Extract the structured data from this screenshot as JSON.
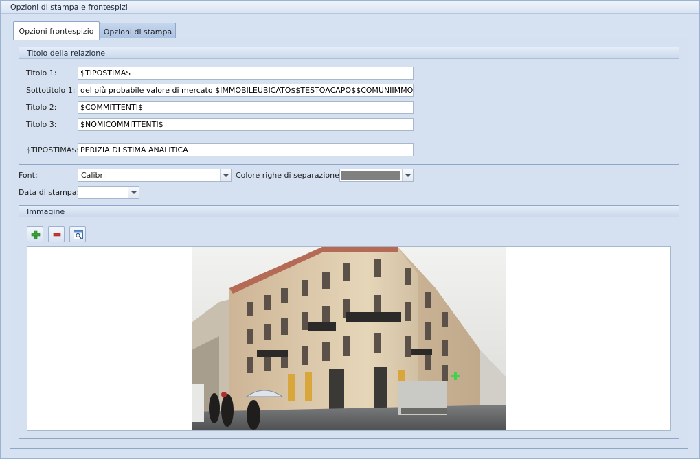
{
  "window": {
    "title": "Opzioni di stampa e frontespizi"
  },
  "tabs": [
    {
      "label": "Opzioni frontespizio",
      "active": true
    },
    {
      "label": "Opzioni di stampa",
      "active": false
    }
  ],
  "titolo_relazione": {
    "header": "Titolo della relazione",
    "fields": [
      {
        "label": "Titolo 1:",
        "value": "$TIPOSTIMA$"
      },
      {
        "label": "Sottotitolo 1:",
        "value": "del più probabile valore di mercato $IMMOBILEUBICATO$$TESTOACAPO$$COMUNIIMMOBILI$"
      },
      {
        "label": "Titolo 2:",
        "value": "$COMMITTENTI$"
      },
      {
        "label": "Titolo 3:",
        "value": "$NOMICOMMITTENTI$"
      }
    ],
    "variable": {
      "label": "$TIPOSTIMA$:",
      "value": "PERIZIA DI STIMA ANALITICA"
    }
  },
  "font": {
    "label": "Font:",
    "value": "Calibri"
  },
  "colore": {
    "label": "Colore righe di separazione:",
    "swatch_color": "#808080"
  },
  "data_stampa": {
    "label": "Data di stampa:",
    "value": ""
  },
  "immagine": {
    "header": "Immagine",
    "toolbar": [
      {
        "icon": "add-icon"
      },
      {
        "icon": "remove-icon"
      },
      {
        "icon": "preview-icon"
      }
    ]
  },
  "colors": {
    "accent_green": "#3aa33a",
    "remove_red": "#d0342c",
    "panel_bg": "#d5e1f0"
  }
}
